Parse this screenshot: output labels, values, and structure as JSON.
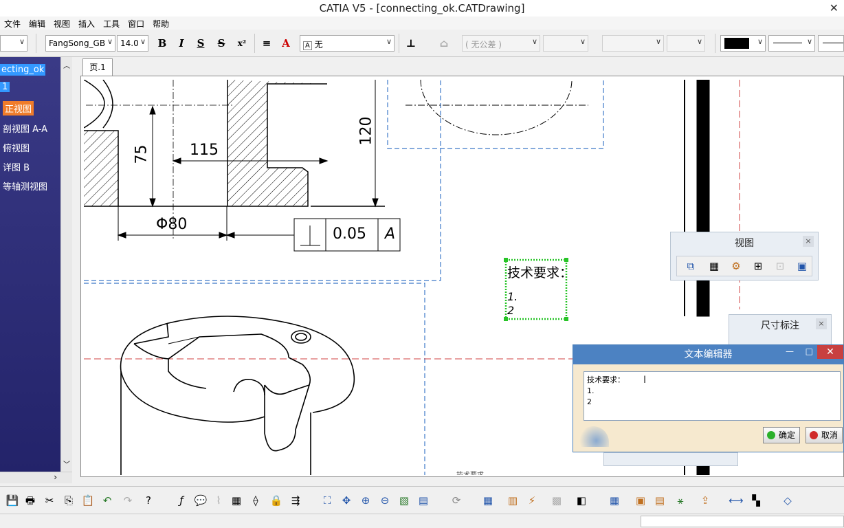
{
  "window": {
    "title": "CATIA V5 - [connecting_ok.CATDrawing]",
    "close_glyph": "✕"
  },
  "menu": [
    "文件",
    "编辑",
    "视图",
    "插入",
    "工具",
    "窗口",
    "帮助"
  ],
  "toolbar": {
    "style_combo": "",
    "font_combo": "FangSong_GB",
    "size_combo": "14.0",
    "bold": "B",
    "italic": "I",
    "underline": "S",
    "strike": "S",
    "superscript": "x²",
    "frame_combo": "无",
    "tolerance_combo": "( 无公差 )",
    "color_hex": "#000000"
  },
  "tree": {
    "root": "ecting_ok",
    "sheet": "1",
    "items": [
      "正视图",
      "剖视图 A-A",
      "俯视图",
      "详图 B",
      "等轴测视图"
    ]
  },
  "sheet_tab": "页.1",
  "drawing": {
    "dim_75": "75",
    "dim_115": "115",
    "dim_120": "120",
    "dim_phi80": "Φ80",
    "tol_value": "0.05",
    "tol_datum": "A",
    "text_box_heading": "技术要求：",
    "text_box_line1": "1.",
    "text_box_line2": "2",
    "hidden_text": "技术要求"
  },
  "panels": {
    "view_title": "视图",
    "dim_title": "尺寸标注",
    "close_glyph": "×"
  },
  "editor": {
    "title": "文本编辑器",
    "line1": "技术要求：",
    "line2": "1.",
    "line3": "2",
    "ok": "确定",
    "cancel": "取消",
    "close_glyph": "✕",
    "max_glyph": "□",
    "min_glyph": "—"
  },
  "colors": {
    "accent_blue": "#3399ff",
    "active_orange": "#f07c2a",
    "dash_blue": "#3c78c8",
    "dash_red": "#d04040",
    "selection_green": "#27c427"
  }
}
